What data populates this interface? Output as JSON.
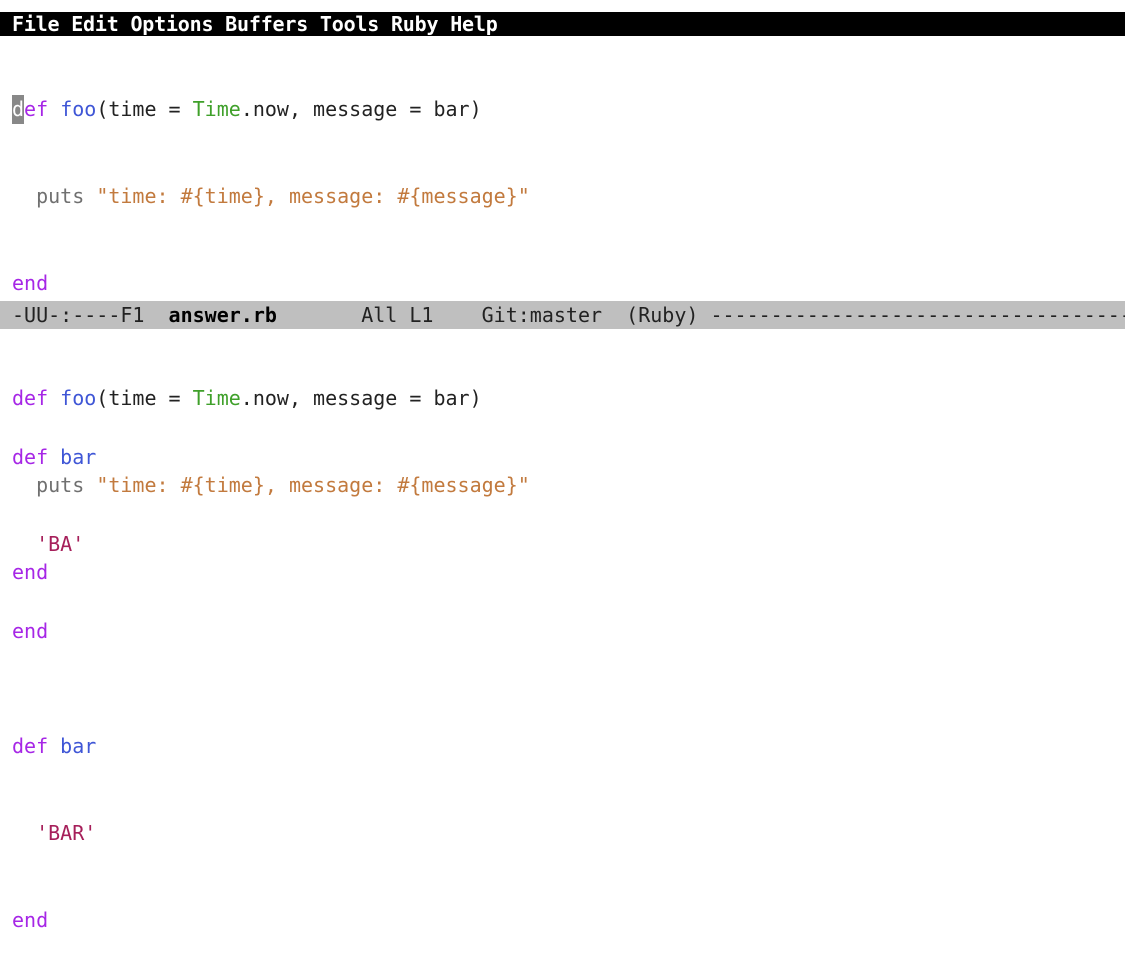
{
  "menu": [
    "File",
    "Edit",
    "Options",
    "Buffers",
    "Tools",
    "Ruby",
    "Help"
  ],
  "modeline": {
    "status": "-UU-:----F1",
    "buffer": "answer.rb",
    "position": "All L1",
    "vc": "Git:master",
    "mode": "(Ruby)",
    "fill": "----------------------------------------"
  },
  "top_pane": {
    "cursor_char": "d",
    "l1_def_rest": "ef",
    "l1_fn": "foo",
    "l1_open": "(time = ",
    "l1_const": "Time",
    "l1_rest": ".now, message = bar)",
    "l2_puts": "puts",
    "l2_str": "\"time: #{time}, message: #{message}\"",
    "l3": "end",
    "l5_def": "def",
    "l5_fn": "bar",
    "l6_str": "'BA'",
    "l7": "end"
  },
  "bottom_pane": {
    "l1_def": "def",
    "l1_fn": "foo",
    "l1_open": "(time = ",
    "l1_const": "Time",
    "l1_rest": ".now, message = bar)",
    "l2_puts": "puts",
    "l2_str": "\"time: #{time}, message: #{message}\"",
    "l3": "end",
    "l5_def": "def",
    "l5_fn": "bar",
    "l6_str": "'BAR'",
    "l7": "end"
  }
}
